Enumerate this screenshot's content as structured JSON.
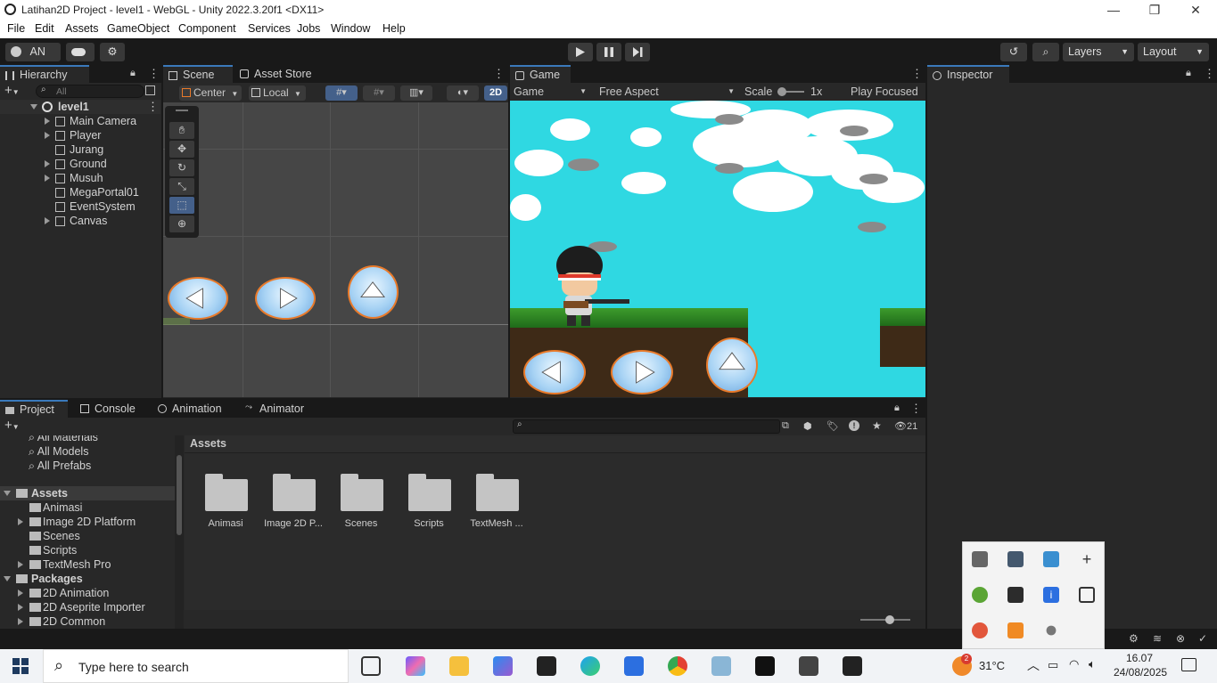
{
  "window": {
    "title": "Latihan2D Project - level1 - WebGL - Unity 2022.3.20f1 <DX11>",
    "controls": [
      "—",
      "❐",
      "✕"
    ]
  },
  "menu": [
    "File",
    "Edit",
    "Assets",
    "GameObject",
    "Component",
    "Services",
    "Jobs",
    "Window",
    "Help"
  ],
  "toolbar": {
    "account": "AN",
    "layers": "Layers",
    "layout": "Layout"
  },
  "hierarchy": {
    "tab": "Hierarchy",
    "search_placeholder": "All",
    "scene": "level1",
    "items": [
      "Main Camera",
      "Player",
      "Jurang",
      "Ground",
      "Musuh",
      "MegaPortal01",
      "EventSystem",
      "Canvas"
    ]
  },
  "scene": {
    "tabs": [
      "Scene",
      "Asset Store"
    ],
    "pivot": "Center",
    "space": "Local",
    "mode2d": "2D"
  },
  "game": {
    "tab": "Game",
    "display": "Game",
    "aspect": "Free Aspect",
    "scale_label": "Scale",
    "scale_value": "1x",
    "play_mode": "Play Focused"
  },
  "inspector": {
    "tab": "Inspector"
  },
  "bottom": {
    "tabs": [
      "Project",
      "Console",
      "Animation",
      "Animator"
    ],
    "hidden_count": "21",
    "breadcrumb": "Assets",
    "favorites": [
      "All Materials",
      "All Models",
      "All Prefabs"
    ],
    "assets_root": "Assets",
    "assets_children": [
      "Animasi",
      "Image 2D Platform",
      "Scenes",
      "Scripts",
      "TextMesh Pro"
    ],
    "packages_root": "Packages",
    "packages_children": [
      "2D Animation",
      "2D Aseprite Importer",
      "2D Common"
    ],
    "folders": [
      "Animasi",
      "Image 2D P...",
      "Scenes",
      "Scripts",
      "TextMesh ..."
    ]
  },
  "taskbar": {
    "search_placeholder": "Type here to search",
    "weather": "31°C",
    "weather_badge": "2",
    "time": "16.07",
    "date": "24/08/2025"
  },
  "colors": {
    "accent": "#3a79bb",
    "game_sky": "#2fd8e2",
    "button_outline": "#e97a2a"
  }
}
